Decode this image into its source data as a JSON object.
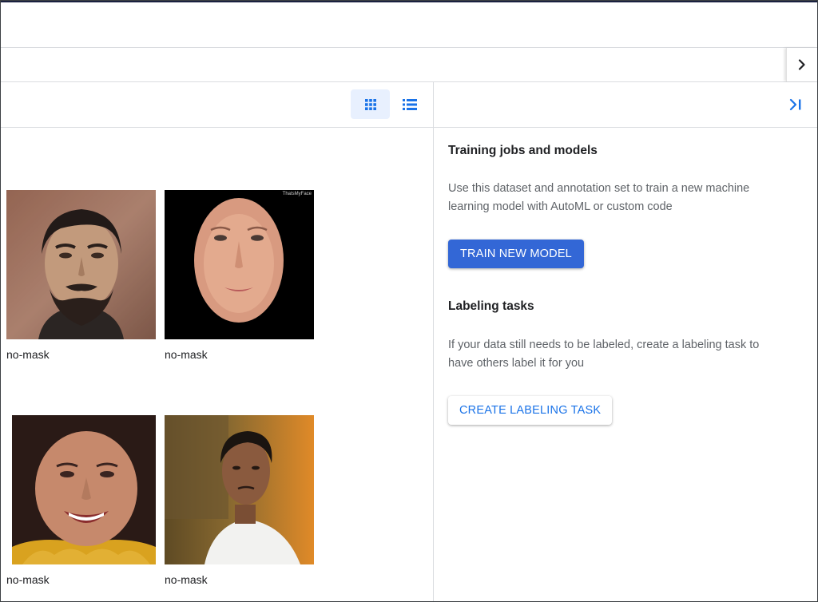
{
  "colors": {
    "accent": "#1a73e8",
    "primary_button": "#3367d6",
    "selected_view_bg": "#e8f0fe",
    "divider": "#dadce0"
  },
  "header": {
    "expand_icon": "chevron-right-icon"
  },
  "view_toggle": {
    "grid_icon": "grid-view-icon",
    "list_icon": "list-view-icon",
    "selected": "grid"
  },
  "gallery": {
    "items": [
      {
        "label": "no-mask",
        "icon": "photo-thumbnail"
      },
      {
        "label": "no-mask",
        "icon": "photo-thumbnail"
      },
      {
        "label": "no-mask",
        "icon": "photo-thumbnail"
      },
      {
        "label": "no-mask",
        "icon": "photo-thumbnail"
      }
    ],
    "watermark_text": "ThatsMyFace"
  },
  "side_panel": {
    "collapse_icon": "collapse-panel-icon",
    "training": {
      "title": "Training jobs and models",
      "description": "Use this dataset and annotation set to train a new machine learning model with AutoML or custom code",
      "button": "TRAIN NEW MODEL"
    },
    "labeling": {
      "title": "Labeling tasks",
      "description": "If your data still needs to be labeled, create a labeling task to have others label it for you",
      "button": "CREATE LABELING TASK"
    }
  }
}
